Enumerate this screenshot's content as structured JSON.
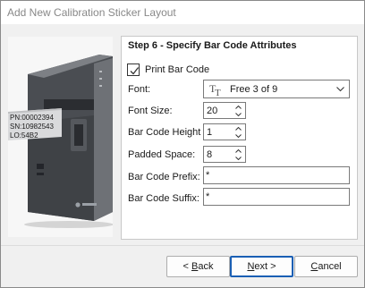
{
  "window": {
    "title": "Add New Calibration Sticker Layout"
  },
  "step": {
    "title": "Step 6 - Specify Bar Code Attributes"
  },
  "print_bar_code": {
    "label": "Print Bar Code",
    "checked": true
  },
  "fields": {
    "font": {
      "label": "Font:",
      "value": "Free 3 of 9",
      "icon": "truetype-font-icon"
    },
    "font_size": {
      "label": "Font Size:",
      "value": "20"
    },
    "bar_code_height": {
      "label": "Bar Code Height",
      "value": "1"
    },
    "padded_space": {
      "label": "Padded Space:",
      "value": "8"
    },
    "prefix": {
      "label": "Bar Code Prefix:",
      "value": "*"
    },
    "suffix": {
      "label": "Bar Code Suffix:",
      "value": "*"
    }
  },
  "sticker": {
    "lines": [
      "PN:00002394",
      "SN:10982543",
      "LO:54B2"
    ]
  },
  "buttons": {
    "back": {
      "prefix": "< ",
      "mnemonic": "B",
      "rest": "ack"
    },
    "next": {
      "mnemonic": "N",
      "rest": "ext >"
    },
    "cancel": {
      "mnemonic": "C",
      "rest": "ancel"
    }
  },
  "colors": {
    "accent": "#1a5fb4",
    "panel_bg": "#ffffff",
    "dialog_bg": "#f0f0f0"
  }
}
